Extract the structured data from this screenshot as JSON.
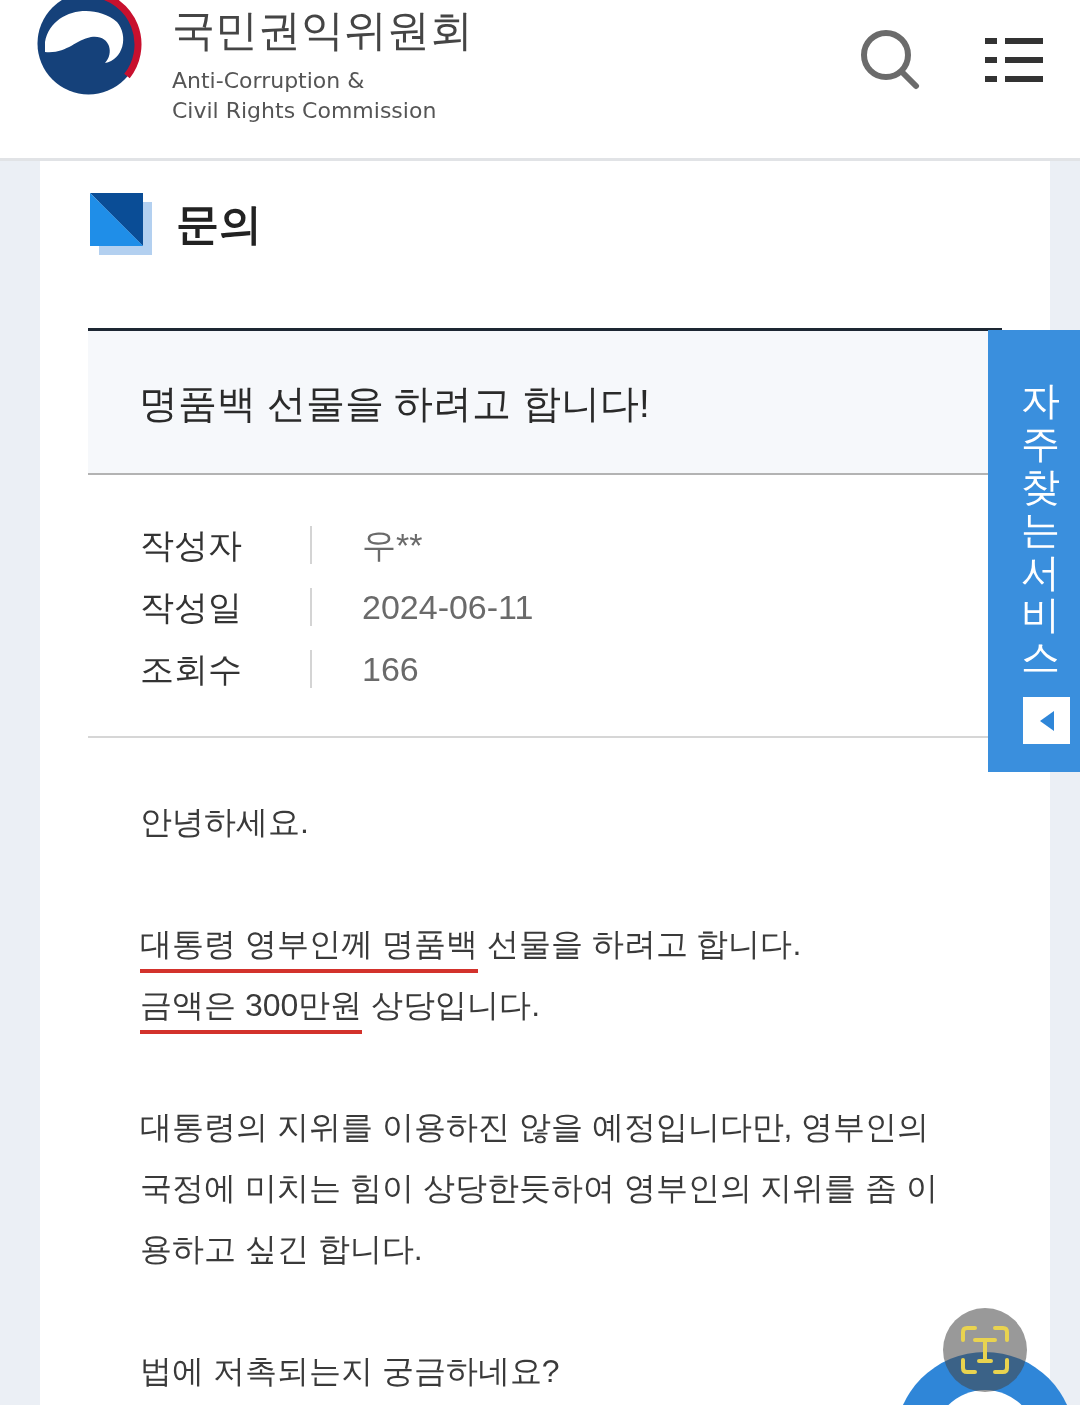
{
  "header": {
    "org_name_korean": "국민권익위원회",
    "org_name_english": [
      "Anti-Corruption &",
      "Civil Rights Commission"
    ]
  },
  "page_heading": "문의",
  "post": {
    "title": "명품백 선물을 하려고 합니다!",
    "meta": [
      {
        "label": "작성자",
        "value": "우**"
      },
      {
        "label": "작성일",
        "value": "2024-06-11"
      },
      {
        "label": "조회수",
        "value": "166"
      }
    ],
    "body": [
      {
        "lines": [
          {
            "segments": [
              {
                "text": "안녕하세요.",
                "underlined": false
              }
            ]
          }
        ]
      },
      {
        "lines": [
          {
            "segments": [
              {
                "text": "대통령 영부인께 명품백",
                "underlined": true
              },
              {
                "text": "선물을 하려고 합니다.",
                "underlined": false
              }
            ]
          },
          {
            "segments": [
              {
                "text": "금액은 300만원",
                "underlined": true
              },
              {
                "text": "상당입니다.",
                "underlined": false
              }
            ]
          }
        ]
      },
      {
        "lines": [
          {
            "segments": [
              {
                "text": "대통령의 지위를 이용하진 않을 예정입니다만, 영부인의 국정에 미치는 힘이 상당한듯하여 영부인의 지위를 좀 이용하고 싶긴 합니다.",
                "underlined": false
              }
            ]
          }
        ]
      },
      {
        "lines": [
          {
            "segments": [
              {
                "text": "법에 저촉되는지 궁금하네요?",
                "underlined": false
              }
            ]
          }
        ]
      }
    ]
  },
  "quick_menu": {
    "label": "자주찾는 서비스"
  }
}
